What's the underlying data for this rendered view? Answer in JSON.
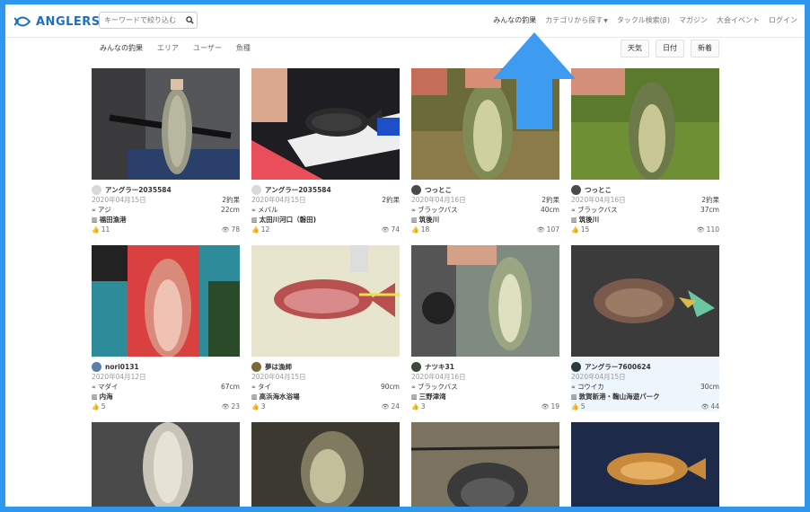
{
  "header": {
    "logo_text": "ANGLERS",
    "search_placeholder": "キーワードで絞り込む",
    "nav": [
      {
        "label": "みんなの釣果",
        "active": true
      },
      {
        "label": "カテゴリから探す",
        "dropdown": true
      },
      {
        "label": "タックル検索(β)"
      },
      {
        "label": "マガジン"
      },
      {
        "label": "大会イベント"
      },
      {
        "label": "ログイン"
      }
    ]
  },
  "subtabs": [
    "みんなの釣果",
    "エリア",
    "ユーザー",
    "魚種"
  ],
  "sort_buttons": [
    "天気",
    "日付",
    "新着"
  ],
  "colors": {
    "frame": "#2f97ee",
    "logo": "#1d6fc0",
    "arrow": "#3d9cf0"
  },
  "cards": [
    {
      "user": "アングラー2035584",
      "date": "2020年04月15日",
      "catches": "2釣果",
      "species": "アジ",
      "size": "22cm",
      "place": "福田漁港",
      "likes": "11",
      "views": "78"
    },
    {
      "user": "アングラー2035584",
      "date": "2020年04月15日",
      "catches": "2釣果",
      "species": "メバル",
      "size": "",
      "place": "太田川河口（磐田)",
      "likes": "12",
      "views": "74"
    },
    {
      "user": "つっとこ",
      "date": "2020年04月16日",
      "catches": "2釣果",
      "species": "ブラックバス",
      "size": "40cm",
      "place": "筑後川",
      "likes": "18",
      "views": "107"
    },
    {
      "user": "つっとこ",
      "date": "2020年04月16日",
      "catches": "2釣果",
      "species": "ブラックバス",
      "size": "37cm",
      "place": "筑後川",
      "likes": "15",
      "views": "110"
    },
    {
      "user": "nori0131",
      "date": "2020年04月12日",
      "catches": "",
      "species": "マダイ",
      "size": "67cm",
      "place": "内海",
      "likes": "5",
      "views": "23"
    },
    {
      "user": "夢は漁師",
      "date": "2020年04月15日",
      "catches": "",
      "species": "タイ",
      "size": "90cm",
      "place": "高浜海水浴場",
      "likes": "3",
      "views": "24"
    },
    {
      "user": "ナツキ31",
      "date": "2020年04月16日",
      "catches": "",
      "species": "ブラックバス",
      "size": "",
      "place": "三野津湾",
      "likes": "3",
      "views": "19"
    },
    {
      "user": "アングラー7600624",
      "date": "2020年04月15日",
      "catches": "",
      "species": "コウイカ",
      "size": "30cm",
      "place": "敦賀新港・鞠山海遊パーク",
      "likes": "5",
      "views": "44"
    }
  ]
}
